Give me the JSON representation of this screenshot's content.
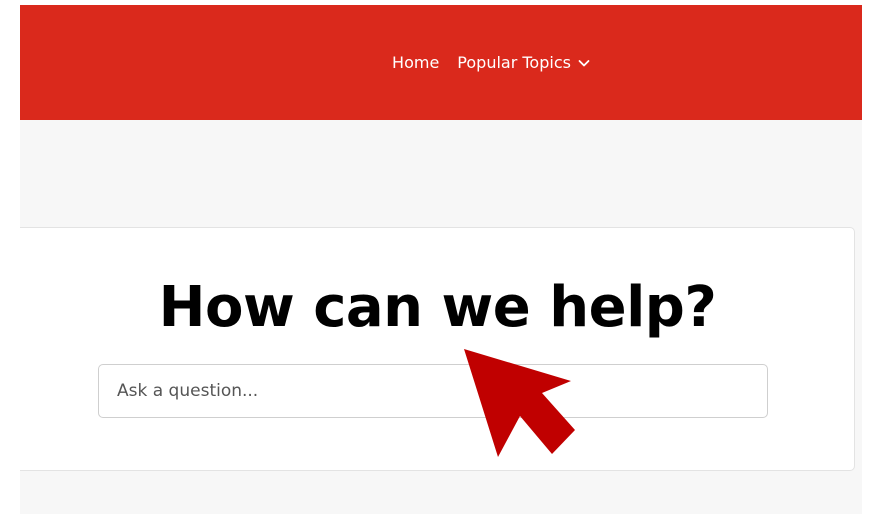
{
  "nav": {
    "home_label": "Home",
    "popular_topics_label": "Popular Topics",
    "popular_topics_icon": "chevron-down-icon"
  },
  "hero": {
    "heading": "How can we help?",
    "search_placeholder": "Ask a question..."
  },
  "overlay": {
    "icon": "arrow-pointer-icon"
  },
  "colors": {
    "navbar_bg": "#da291c",
    "page_bg": "#f7f7f7",
    "arrow": "#c00000"
  }
}
